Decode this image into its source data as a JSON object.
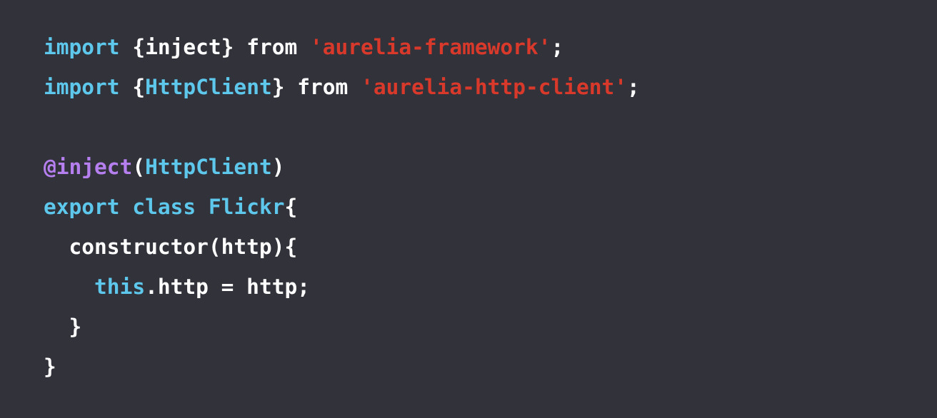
{
  "colors": {
    "background": "#31323a",
    "plain": "#ffffff",
    "keyword": "#5ec8ec",
    "string": "#d9392a",
    "decorator": "#b67fef",
    "type": "#5ec8ec"
  },
  "code": {
    "lines": [
      [
        {
          "t": "import",
          "k": "keyword"
        },
        {
          "t": " {inject} ",
          "k": "plain"
        },
        {
          "t": "from",
          "k": "plain"
        },
        {
          "t": " ",
          "k": "plain"
        },
        {
          "t": "'aurelia-framework'",
          "k": "string"
        },
        {
          "t": ";",
          "k": "plain"
        }
      ],
      [
        {
          "t": "import",
          "k": "keyword"
        },
        {
          "t": " {",
          "k": "plain"
        },
        {
          "t": "HttpClient",
          "k": "type"
        },
        {
          "t": "} ",
          "k": "plain"
        },
        {
          "t": "from",
          "k": "plain"
        },
        {
          "t": " ",
          "k": "plain"
        },
        {
          "t": "'aurelia-http-client'",
          "k": "string"
        },
        {
          "t": ";",
          "k": "plain"
        }
      ],
      [],
      [
        {
          "t": "@inject",
          "k": "decorator"
        },
        {
          "t": "(",
          "k": "plain"
        },
        {
          "t": "HttpClient",
          "k": "type"
        },
        {
          "t": ")",
          "k": "plain"
        }
      ],
      [
        {
          "t": "export",
          "k": "keyword"
        },
        {
          "t": " ",
          "k": "plain"
        },
        {
          "t": "class",
          "k": "keyword"
        },
        {
          "t": " ",
          "k": "plain"
        },
        {
          "t": "Flickr",
          "k": "type"
        },
        {
          "t": "{",
          "k": "plain"
        }
      ],
      [
        {
          "t": "  constructor(http){",
          "k": "plain"
        }
      ],
      [
        {
          "t": "    ",
          "k": "plain"
        },
        {
          "t": "this",
          "k": "keyword"
        },
        {
          "t": ".http = http;",
          "k": "plain"
        }
      ],
      [
        {
          "t": "  }",
          "k": "plain"
        }
      ],
      [
        {
          "t": "}",
          "k": "plain"
        }
      ]
    ]
  }
}
